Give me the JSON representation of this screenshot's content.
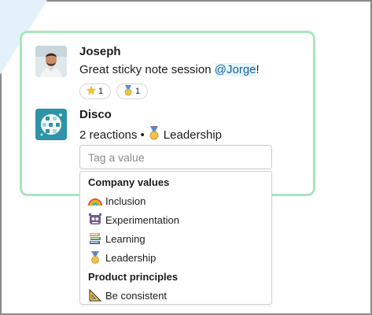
{
  "messages": [
    {
      "author": "Joseph",
      "text": "Great sticky note session ",
      "mention": "@Jorge",
      "suffix": "!",
      "reactions": [
        {
          "emoji": "star",
          "count": "1"
        },
        {
          "emoji": "medal",
          "count": "1"
        }
      ]
    },
    {
      "author": "Disco",
      "reactions_text": "2 reactions •",
      "tag_label": "Leadership"
    }
  ],
  "tag_input": {
    "placeholder": "Tag a value"
  },
  "dropdown": {
    "groups": [
      {
        "label": "Company values",
        "options": [
          {
            "label": "Inclusion",
            "icon": "rainbow-icon"
          },
          {
            "label": "Experimentation",
            "icon": "alien-monster-icon"
          },
          {
            "label": "Learning",
            "icon": "books-icon"
          },
          {
            "label": "Leadership",
            "icon": "medal-icon"
          }
        ]
      },
      {
        "label": "Product principles",
        "options": [
          {
            "label": "Be consistent",
            "icon": "triangular-ruler-icon"
          }
        ]
      }
    ]
  },
  "colors": {
    "card_border": "#a6e6bd",
    "mention": "#1264a3",
    "corner": "#e3f1fb"
  }
}
